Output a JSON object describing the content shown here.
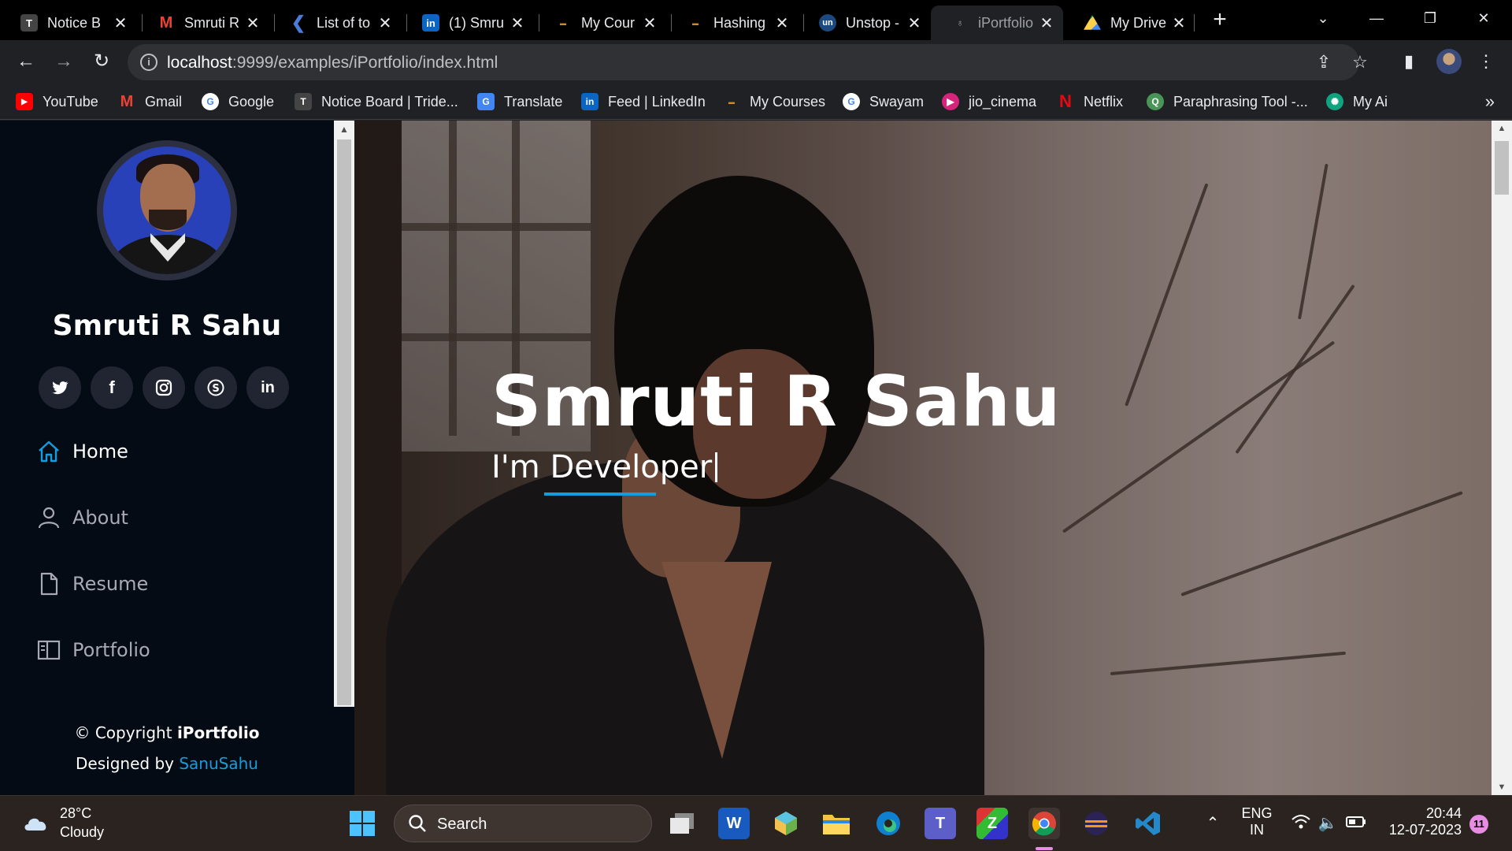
{
  "browser": {
    "tabs": [
      {
        "title": "Notice B",
        "favicon": "trident-icon",
        "color": "#444444",
        "active": false
      },
      {
        "title": "Smruti R",
        "favicon": "gmail-icon",
        "color": "#ea4335",
        "active": false
      },
      {
        "title": "List of to",
        "favicon": "k-icon",
        "color": "#4a7bd6",
        "active": false
      },
      {
        "title": "(1) Smru",
        "favicon": "linkedin-icon",
        "color": "#0a66c2",
        "active": false
      },
      {
        "title": "My Cour",
        "favicon": "college-icon",
        "color": "#d48a1c",
        "active": false
      },
      {
        "title": "Hashing",
        "favicon": "college-icon",
        "color": "#d48a1c",
        "active": false
      },
      {
        "title": "Unstop -",
        "favicon": "unstop-icon",
        "color": "#1c4980",
        "active": false
      },
      {
        "title": "iPortfolio",
        "favicon": "iportfolio-icon",
        "color": "#333333",
        "active": true
      },
      {
        "title": "My Drive",
        "favicon": "drive-icon",
        "color": "#1fa463",
        "active": false
      }
    ],
    "url_host": "localhost",
    "url_path": ":9999/examples/iPortfolio/index.html",
    "bookmarks": [
      {
        "label": "YouTube",
        "icon": "youtube-icon",
        "color": "#ff0000"
      },
      {
        "label": "Gmail",
        "icon": "gmail-icon",
        "color": "#ea4335"
      },
      {
        "label": "Google",
        "icon": "google-icon",
        "color": "#4285f4"
      },
      {
        "label": "Notice Board | Tride...",
        "icon": "trident-icon",
        "color": "#444444"
      },
      {
        "label": "Translate",
        "icon": "translate-icon",
        "color": "#4285f4"
      },
      {
        "label": "Feed | LinkedIn",
        "icon": "linkedin-icon",
        "color": "#0a66c2"
      },
      {
        "label": "My Courses",
        "icon": "college-icon",
        "color": "#d48a1c"
      },
      {
        "label": "Swayam",
        "icon": "google-icon",
        "color": "#4285f4"
      },
      {
        "label": "jio_cinema",
        "icon": "jiocinema-icon",
        "color": "#d6247a"
      },
      {
        "label": "Netflix",
        "icon": "netflix-icon",
        "color": "#e50914"
      },
      {
        "label": "Paraphrasing Tool -...",
        "icon": "quillbot-icon",
        "color": "#499557"
      },
      {
        "label": "My Ai",
        "icon": "chatgpt-icon",
        "color": "#10a37f"
      }
    ]
  },
  "sidebar": {
    "name": "Smruti R Sahu",
    "socials": [
      {
        "glyph": "🐦",
        "icon": "twitter-icon"
      },
      {
        "glyph": "f",
        "icon": "facebook-icon"
      },
      {
        "glyph": "◎",
        "icon": "instagram-icon"
      },
      {
        "glyph": "S",
        "icon": "skype-icon"
      },
      {
        "glyph": "in",
        "icon": "linkedin-icon"
      }
    ],
    "nav": [
      {
        "label": "Home",
        "icon": "home-icon",
        "active": true
      },
      {
        "label": "About",
        "icon": "person-icon",
        "active": false
      },
      {
        "label": "Resume",
        "icon": "file-icon",
        "active": false
      },
      {
        "label": "Portfolio",
        "icon": "book-icon",
        "active": false
      }
    ],
    "copyright_prefix": "© Copyright ",
    "copyright_brand": "iPortfolio",
    "designed_prefix": "Designed by ",
    "designed_link": "SanuSahu"
  },
  "hero": {
    "title": "Smruti R Sahu",
    "subtitle": "I'm Developer",
    "accent": "#149ddd"
  },
  "taskbar": {
    "temperature": "28°C",
    "weather": "Cloudy",
    "search_placeholder": "Search",
    "language_line1": "ENG",
    "language_line2": "IN",
    "time": "20:44",
    "date": "12-07-2023",
    "notifications": "11"
  }
}
